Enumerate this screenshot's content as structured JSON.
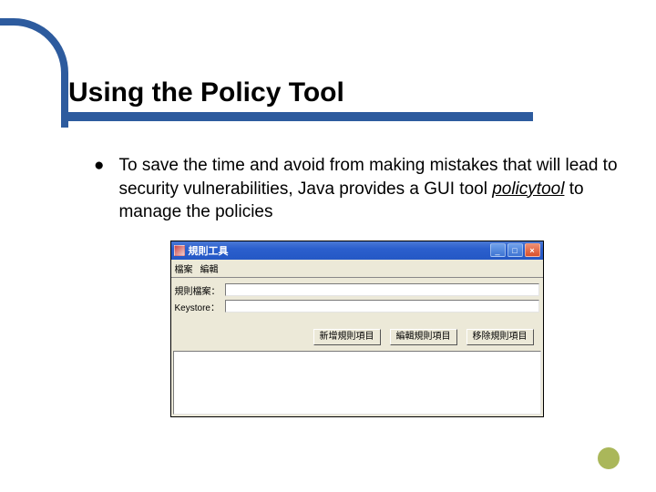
{
  "slide": {
    "title": "Using the Policy Tool",
    "bullet": {
      "text_before": "To save the time and avoid from making mistakes that will lead to security vulnerabilities, Java provides a GUI tool ",
      "tool_name": "policytool",
      "text_after": " to manage the policies"
    }
  },
  "policytool": {
    "window_title": "規則工具",
    "menu": {
      "file": "檔案",
      "edit": "編輯"
    },
    "fields": {
      "policy_file_label": "規則檔案：",
      "policy_file_value": "",
      "keystore_label": "Keystore：",
      "keystore_value": ""
    },
    "buttons": {
      "add": "新增規則項目",
      "edit": "編輯規則項目",
      "remove": "移除規則項目"
    }
  }
}
